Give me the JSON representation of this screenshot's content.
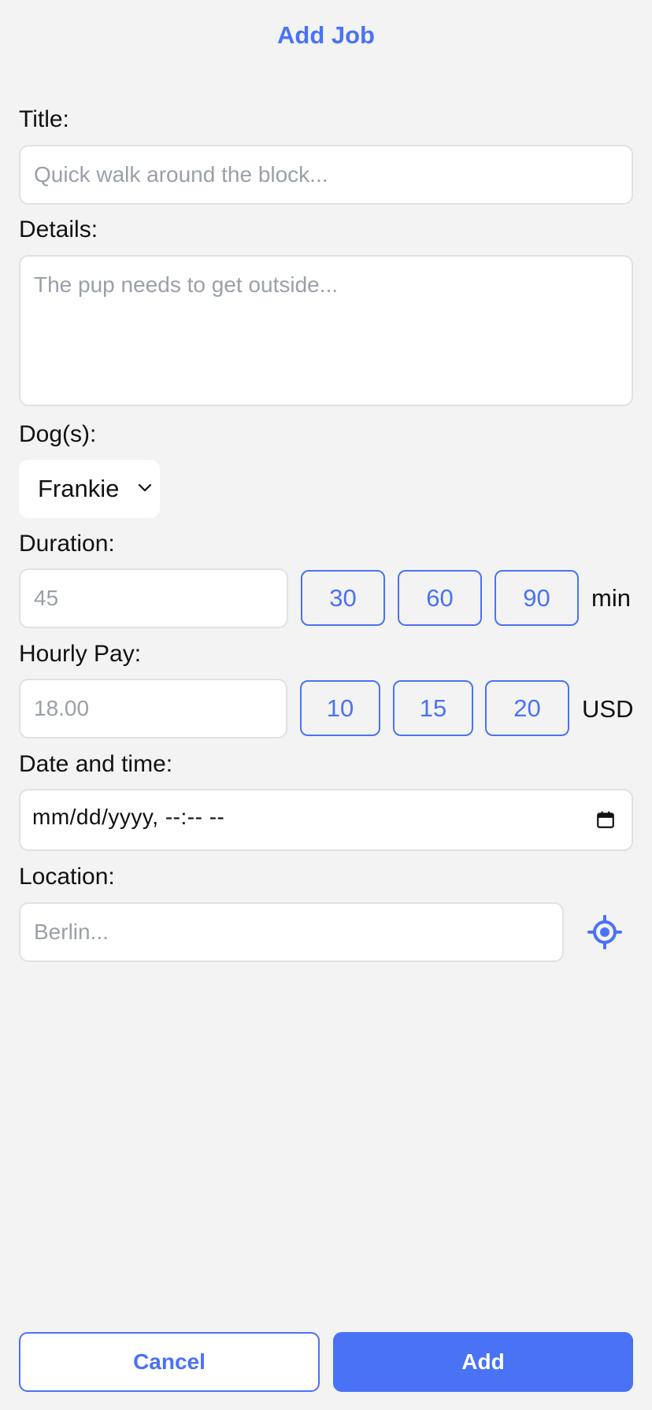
{
  "header": {
    "title": "Add Job"
  },
  "form": {
    "title": {
      "label": "Title:",
      "placeholder": "Quick walk around the block..."
    },
    "details": {
      "label": "Details:",
      "placeholder": "The pup needs to get outside..."
    },
    "dogs": {
      "label": "Dog(s):",
      "selected": "Frankie"
    },
    "duration": {
      "label": "Duration:",
      "placeholder": "45",
      "presets": [
        "30",
        "60",
        "90"
      ],
      "unit": "min"
    },
    "hourly_pay": {
      "label": "Hourly Pay:",
      "placeholder": "18.00",
      "presets": [
        "10",
        "15",
        "20"
      ],
      "unit": "USD"
    },
    "datetime": {
      "label": "Date and time:",
      "value": "mm/dd/yyyy, --:-- --"
    },
    "location": {
      "label": "Location:",
      "placeholder": "Berlin..."
    }
  },
  "actions": {
    "cancel_label": "Cancel",
    "add_label": "Add"
  },
  "colors": {
    "accent": "#4a72f5",
    "background": "#f3f3f3",
    "placeholder": "#9aa0a8",
    "field_border": "#e1e1e1"
  },
  "icons": {
    "dogs_select": "chevron-down-icon",
    "datetime": "calendar-icon",
    "location": "locate-icon"
  }
}
